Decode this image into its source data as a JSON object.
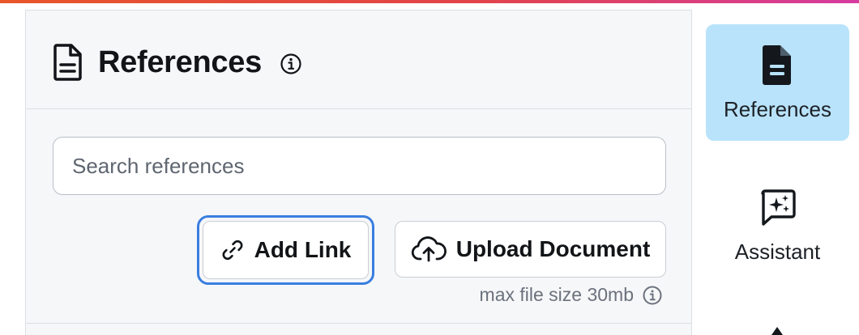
{
  "header": {
    "title": "References",
    "title_icon": "document-icon",
    "info_icon": "info-icon"
  },
  "search": {
    "placeholder": "Search references",
    "value": ""
  },
  "actions": {
    "add_link_label": "Add Link",
    "add_link_icon": "link-icon",
    "upload_label": "Upload Document",
    "upload_icon": "cloud-upload-icon",
    "max_size_text": "max file size 30mb"
  },
  "rail": {
    "items": [
      {
        "label": "References",
        "icon": "document-icon",
        "active": true
      },
      {
        "label": "Assistant",
        "icon": "sparkle-chat-icon",
        "active": false
      }
    ]
  },
  "colors": {
    "accent_gradient": [
      "#e8562a",
      "#d63ca0"
    ],
    "active_rail": "#b9e3fb",
    "focus_ring": "#3a7ee0"
  }
}
